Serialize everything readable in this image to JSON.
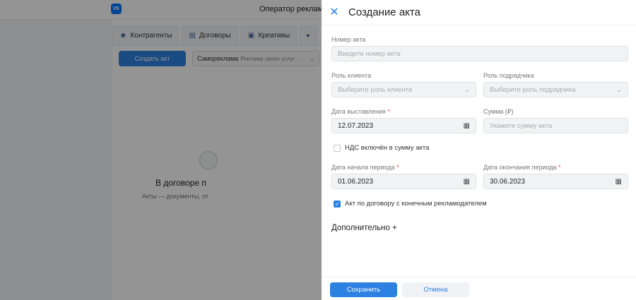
{
  "background": {
    "app_title": "Оператор рекламн",
    "logo_text": "VK",
    "tabs": [
      {
        "label": "Контрагенты",
        "icon": "person-icon"
      },
      {
        "label": "Договоры",
        "icon": "book-icon"
      },
      {
        "label": "Креативы",
        "icon": "creative-icon"
      }
    ],
    "create_button": "Создать акт",
    "contract_select": {
      "value": "Самореклама",
      "hint": "Реклама своих услуг ..."
    },
    "empty_title": "В договоре п",
    "empty_subtitle": "Акты — документы, от"
  },
  "dialog": {
    "title": "Создание акта",
    "fields": {
      "act_number": {
        "label": "Номер акта",
        "placeholder": "Введите номер акта"
      },
      "client_role": {
        "label": "Роль клиента",
        "placeholder": "Выберите роль клиента"
      },
      "contractor_role": {
        "label": "Роль подрядчика",
        "placeholder": "Выберите роль подрядчика"
      },
      "issue_date": {
        "label": "Дата выставления",
        "required_mark": "*",
        "value": "12.07.2023"
      },
      "amount": {
        "label": "Сумма (₽)",
        "placeholder": "Укажите сумму акта"
      },
      "vat": {
        "label": "НДС включён в сумму акта",
        "checked": false
      },
      "period_start": {
        "label": "Дата начала периода",
        "required_mark": "*",
        "value": "01.06.2023"
      },
      "period_end": {
        "label": "Дата окончания периода",
        "required_mark": "*",
        "value": "30.06.2023"
      },
      "end_advertiser": {
        "label": "Акт по договору с конечным рекламодателем",
        "checked": true
      }
    },
    "more_label": "Дополнительно +",
    "save_label": "Сохранить",
    "cancel_label": "Отмена"
  },
  "colors": {
    "accent": "#2d81e0",
    "required": "#e64646"
  }
}
